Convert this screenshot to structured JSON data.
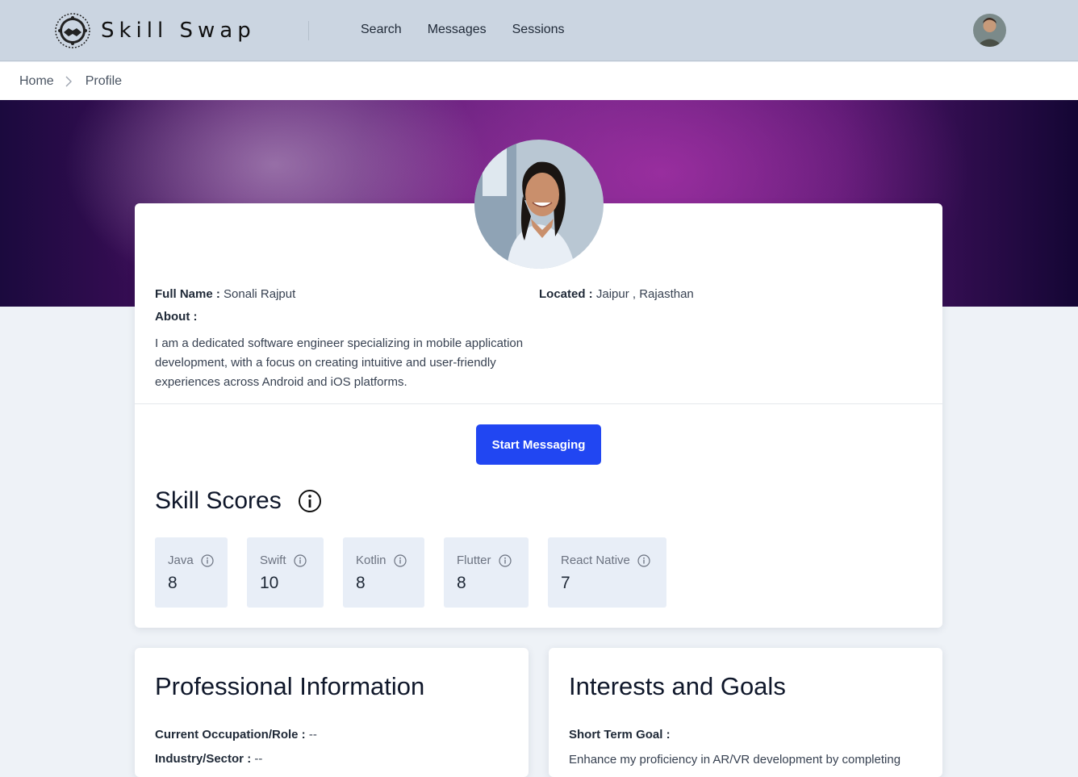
{
  "nav": {
    "brand": "Skill Swap",
    "links": [
      "Search",
      "Messages",
      "Sessions"
    ]
  },
  "breadcrumb": {
    "home": "Home",
    "current": "Profile"
  },
  "profile": {
    "full_name_label": "Full Name :",
    "full_name": "Sonali Rajput",
    "located_label": "Located :",
    "location": "Jaipur , Rajasthan",
    "about_label": "About :",
    "about": "I am a dedicated software engineer specializing in mobile application development, with a focus on creating intuitive and user-friendly experiences across Android and iOS platforms.",
    "message_button": "Start Messaging"
  },
  "skills": {
    "title": "Skill Scores",
    "items": [
      {
        "name": "Java",
        "score": "8"
      },
      {
        "name": "Swift",
        "score": "10"
      },
      {
        "name": "Kotlin",
        "score": "8"
      },
      {
        "name": "Flutter",
        "score": "8"
      },
      {
        "name": "React Native",
        "score": "7"
      }
    ]
  },
  "professional": {
    "title": "Professional Information",
    "occupation_label": "Current Occupation/Role :",
    "occupation": "--",
    "industry_label": "Industry/Sector :",
    "industry": "--"
  },
  "interests": {
    "title": "Interests and Goals",
    "short_term_label": "Short Term Goal :",
    "short_term": "Enhance my proficiency in AR/VR development by completing"
  },
  "colors": {
    "navbar": "#cbd5e1",
    "primary_button": "#2146f2",
    "skill_tile": "#e8eef7",
    "page_bg": "#eef2f7"
  },
  "icons": [
    "brand-logo-icon",
    "chevron-right-icon",
    "info-icon",
    "user-avatar",
    "profile-photo"
  ]
}
